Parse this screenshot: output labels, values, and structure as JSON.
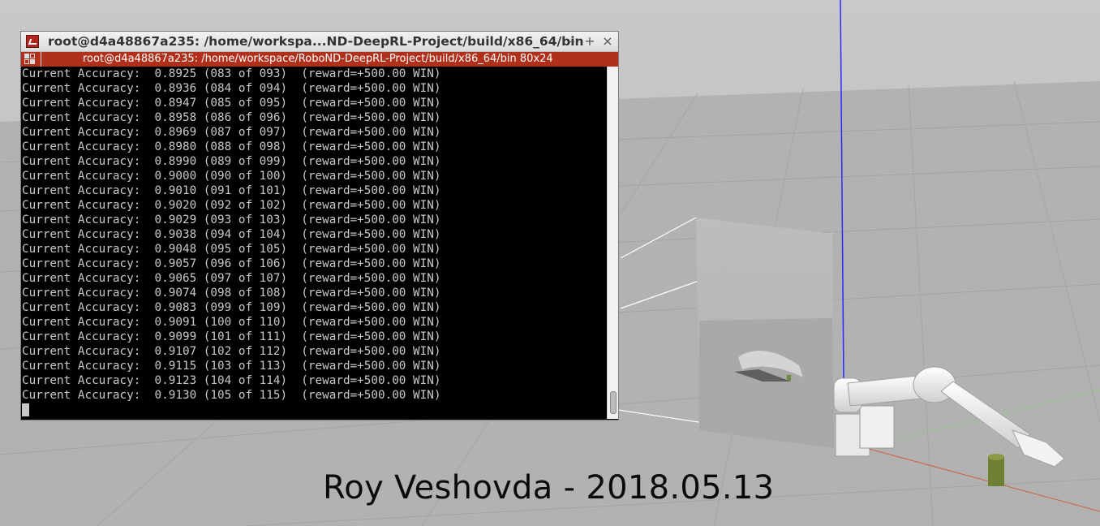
{
  "window": {
    "title": "root@d4a48867a235: /home/workspa...ND-DeepRL-Project/build/x86_64/bin",
    "minimize_label": "–",
    "maximize_label": "+",
    "close_label": "×"
  },
  "tab": {
    "title": "root@d4a48867a235: /home/workspace/RoboND-DeepRL-Project/build/x86_64/bin 80x24"
  },
  "terminal": {
    "lines": [
      "Current Accuracy:  0.8925 (083 of 093)  (reward=+500.00 WIN)",
      "Current Accuracy:  0.8936 (084 of 094)  (reward=+500.00 WIN)",
      "Current Accuracy:  0.8947 (085 of 095)  (reward=+500.00 WIN)",
      "Current Accuracy:  0.8958 (086 of 096)  (reward=+500.00 WIN)",
      "Current Accuracy:  0.8969 (087 of 097)  (reward=+500.00 WIN)",
      "Current Accuracy:  0.8980 (088 of 098)  (reward=+500.00 WIN)",
      "Current Accuracy:  0.8990 (089 of 099)  (reward=+500.00 WIN)",
      "Current Accuracy:  0.9000 (090 of 100)  (reward=+500.00 WIN)",
      "Current Accuracy:  0.9010 (091 of 101)  (reward=+500.00 WIN)",
      "Current Accuracy:  0.9020 (092 of 102)  (reward=+500.00 WIN)",
      "Current Accuracy:  0.9029 (093 of 103)  (reward=+500.00 WIN)",
      "Current Accuracy:  0.9038 (094 of 104)  (reward=+500.00 WIN)",
      "Current Accuracy:  0.9048 (095 of 105)  (reward=+500.00 WIN)",
      "Current Accuracy:  0.9057 (096 of 106)  (reward=+500.00 WIN)",
      "Current Accuracy:  0.9065 (097 of 107)  (reward=+500.00 WIN)",
      "Current Accuracy:  0.9074 (098 of 108)  (reward=+500.00 WIN)",
      "Current Accuracy:  0.9083 (099 of 109)  (reward=+500.00 WIN)",
      "Current Accuracy:  0.9091 (100 of 110)  (reward=+500.00 WIN)",
      "Current Accuracy:  0.9099 (101 of 111)  (reward=+500.00 WIN)",
      "Current Accuracy:  0.9107 (102 of 112)  (reward=+500.00 WIN)",
      "Current Accuracy:  0.9115 (103 of 113)  (reward=+500.00 WIN)",
      "Current Accuracy:  0.9123 (104 of 114)  (reward=+500.00 WIN)",
      "Current Accuracy:  0.9130 (105 of 115)  (reward=+500.00 WIN)"
    ]
  },
  "caption": "Roy Veshovda - 2018.05.13",
  "colors": {
    "tab_bar": "#b1301c",
    "terminal_bg": "#000000",
    "terminal_fg": "#c9c9c9",
    "ground": "#b4b4b4"
  }
}
